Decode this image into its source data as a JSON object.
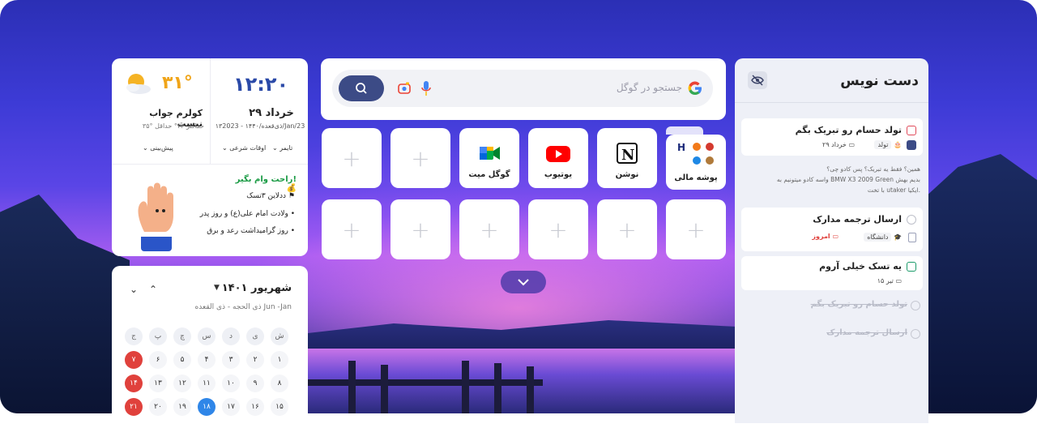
{
  "colors": {
    "accent": "#2b4aa8",
    "holiday": "#e0413c",
    "today": "#2f86e8",
    "green": "#1b9b45",
    "temp": "#f0a51a"
  },
  "clock": {
    "time": "۱۲:۲۰",
    "date": "۲۹ خرداد",
    "sub": "۱۳ذی‌قعده/۱۴۴۰ - 2023/Jan/23"
  },
  "weather": {
    "icon": "partly-cloudy-sun-icon",
    "temp": "۳۱°",
    "desc": "کولرم جواب نیست",
    "minmax": "۳۵° حداکثر  ۲۴° حداقل"
  },
  "chips": {
    "timer": "تایمر",
    "prayer": "اوقات شرعی",
    "forecast": "پیش‌بینی"
  },
  "todo": {
    "title": "راحت وام بگیر!",
    "items": [
      "ددلاین ۳تسک",
      "ولادت امام علی(ع) و روز پدر",
      "روز گرامیداشت رعد و برق"
    ]
  },
  "calendar": {
    "month": "شهریور ۱۴۰۱",
    "sub": "ذی الحجه - ذی القعده  Jun -Jan",
    "weekdays": [
      "ش",
      "ی",
      "د",
      "س",
      "چ",
      "پ",
      "ج"
    ],
    "rows": [
      [
        "۱",
        "۲",
        "۳",
        "۴",
        "۵",
        "۶",
        "۷"
      ],
      [
        "۸",
        "۹",
        "۱۰",
        "۱۱",
        "۱۲",
        "۱۳",
        "۱۴"
      ],
      [
        "۱۵",
        "۱۶",
        "۱۷",
        "۱۸",
        "۱۹",
        "۲۰",
        "۲۱"
      ]
    ],
    "holidays": [
      "۷",
      "۱۴",
      "۲۱"
    ],
    "today": "۱۸"
  },
  "search": {
    "placeholder": "جستجو در گوگل"
  },
  "shortcuts": [
    {
      "label": "پوشه مالی",
      "icon": "bank-folder-icon"
    },
    {
      "label": "نوشن",
      "icon": "notion-icon"
    },
    {
      "label": "یوتیوب",
      "icon": "youtube-icon"
    },
    {
      "label": "گوگل میت",
      "icon": "google-meet-icon"
    }
  ],
  "notes": {
    "title": "دست نویس",
    "cards": [
      {
        "title": "تولد حسام رو تبریک بگم",
        "tag": "تولد",
        "date": "۲۹ خرداد",
        "check_color": "#e04a5a"
      },
      {
        "title": "ارسال ترجمه مدارک",
        "tag": "دانشگاه",
        "date": "امروز",
        "check_color": "#bdbfc9"
      },
      {
        "title": "یه تسک خیلی آروم",
        "date": "۱۵ تیر",
        "check_color": "#1b9b6a"
      }
    ],
    "body": [
      "همین؟ فقط یه تبریک؟ پس کادو چی؟",
      "واسه کادو میتونیم به BMW X3 2009 Green بدیم بهش",
      "با تخت utaker ایکیا."
    ],
    "done": [
      "تولد حسام رو تبریک بگم",
      "ارسال ترجمه مدارک"
    ]
  }
}
